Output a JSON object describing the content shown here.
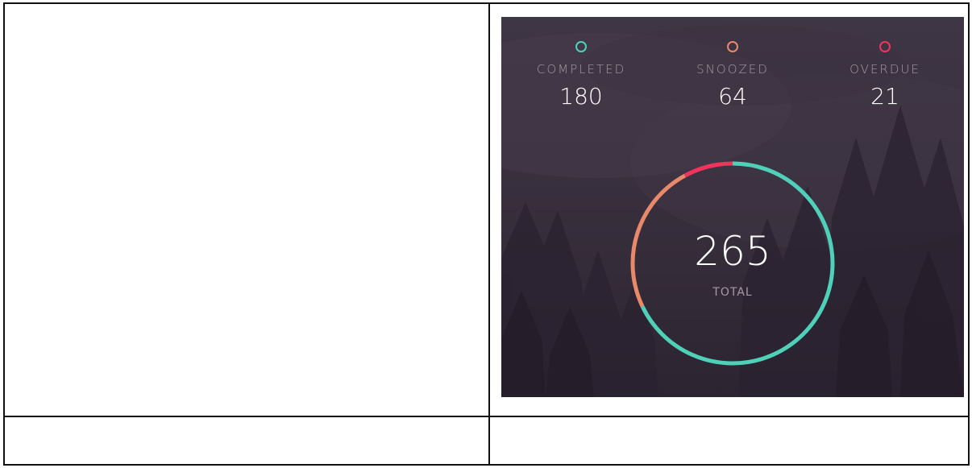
{
  "stats": {
    "completed": {
      "label": "COMPLETED",
      "value": "180",
      "color": "#4fd1b9"
    },
    "snoozed": {
      "label": "SNOOZED",
      "value": "64",
      "color": "#e8896a"
    },
    "overdue": {
      "label": "OVERDUE",
      "value": "21",
      "color": "#f2345d"
    }
  },
  "total": {
    "value": "265",
    "label": "TOTAL"
  },
  "donut": {
    "segments": [
      {
        "name": "completed",
        "value": 180,
        "color": "#4fd1b9"
      },
      {
        "name": "snoozed",
        "value": 64,
        "color": "#e8896a"
      },
      {
        "name": "overdue",
        "value": 21,
        "color": "#f2345d"
      }
    ]
  }
}
